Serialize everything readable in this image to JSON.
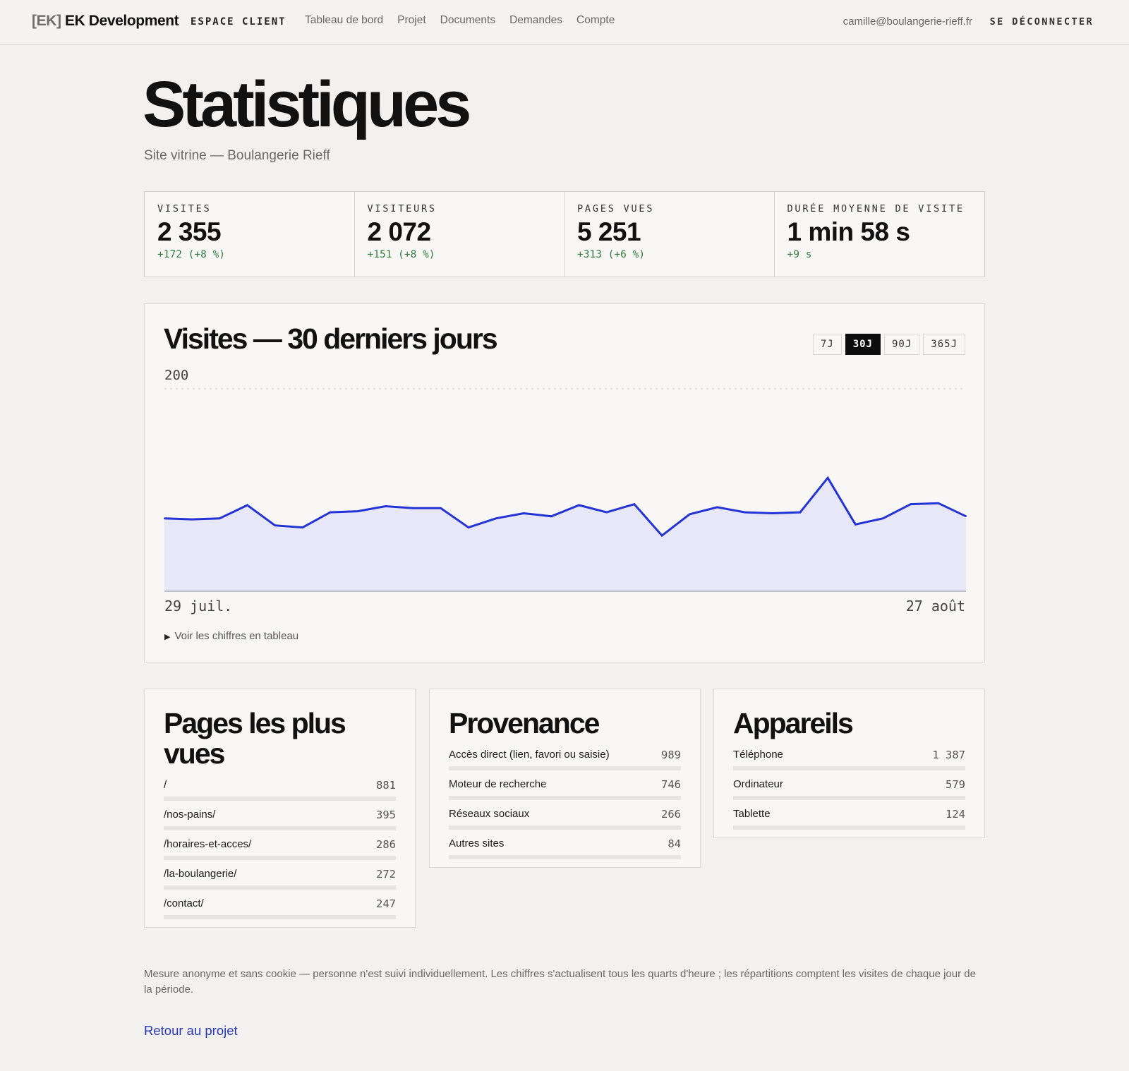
{
  "header": {
    "brand_bracket": "[EK]",
    "brand_name": "EK Development",
    "section": "ESPACE CLIENT",
    "nav": [
      "Tableau de bord",
      "Projet",
      "Documents",
      "Demandes",
      "Compte"
    ],
    "user_email": "camille@boulangerie-rieff.fr",
    "logout_label": "SE DÉCONNECTER"
  },
  "page": {
    "title": "Statistiques",
    "subtitle": "Site vitrine — Boulangerie Rieff"
  },
  "kpis": [
    {
      "label": "VISITES",
      "value": "2 355",
      "delta": "+172 (+8 %)"
    },
    {
      "label": "VISITEURS",
      "value": "2 072",
      "delta": "+151 (+8 %)"
    },
    {
      "label": "PAGES VUES",
      "value": "5 251",
      "delta": "+313 (+6 %)"
    },
    {
      "label": "DURÉE MOYENNE DE VISITE",
      "value": "1 min 58 s",
      "delta": "+9 s"
    }
  ],
  "chart_card": {
    "title": "Visites — 30 derniers jours",
    "ranges": [
      "7J",
      "30J",
      "90J",
      "365J"
    ],
    "active_range": "30J",
    "details_label": "Voir les chiffres en tableau"
  },
  "chart_data": {
    "type": "area",
    "title": "Visites — 30 derniers jours",
    "x_first_label": "29 juil.",
    "x_last_label": "27 août",
    "ymax_label": "200",
    "ylim": [
      0,
      200
    ],
    "grid": "single dashed line at 200",
    "series": [
      {
        "values": [
          72,
          71,
          72,
          85,
          65,
          63,
          78,
          79,
          84,
          82,
          82,
          63,
          72,
          77,
          74,
          85,
          78,
          86,
          55,
          76,
          83,
          78,
          77,
          78,
          112,
          66,
          72,
          86,
          87,
          74
        ]
      }
    ],
    "colors": {
      "line": "#2333d6",
      "fill": "#e8e7f7",
      "axis": "#aaa8b5",
      "grid": "#c8c6c4"
    }
  },
  "panels": {
    "pages": {
      "title": "Pages les plus vues",
      "rows": [
        {
          "label": "/",
          "value": "881"
        },
        {
          "label": "/nos-pains/",
          "value": "395"
        },
        {
          "label": "/horaires-et-acces/",
          "value": "286"
        },
        {
          "label": "/la-boulangerie/",
          "value": "272"
        },
        {
          "label": "/contact/",
          "value": "247"
        }
      ]
    },
    "provenance": {
      "title": "Provenance",
      "rows": [
        {
          "label": "Accès direct (lien, favori ou saisie)",
          "value": "989"
        },
        {
          "label": "Moteur de recherche",
          "value": "746"
        },
        {
          "label": "Réseaux sociaux",
          "value": "266"
        },
        {
          "label": "Autres sites",
          "value": "84"
        }
      ]
    },
    "appareils": {
      "title": "Appareils",
      "rows": [
        {
          "label": "Téléphone",
          "value": "1 387"
        },
        {
          "label": "Ordinateur",
          "value": "579"
        },
        {
          "label": "Tablette",
          "value": "124"
        }
      ]
    }
  },
  "footer": {
    "note": "Mesure anonyme et sans cookie — personne n'est suivi individuellement. Les chiffres s'actualisent tous les quarts d'heure ; les répartitions comptent les visites de chaque jour de la période.",
    "back_link": "Retour au projet"
  }
}
